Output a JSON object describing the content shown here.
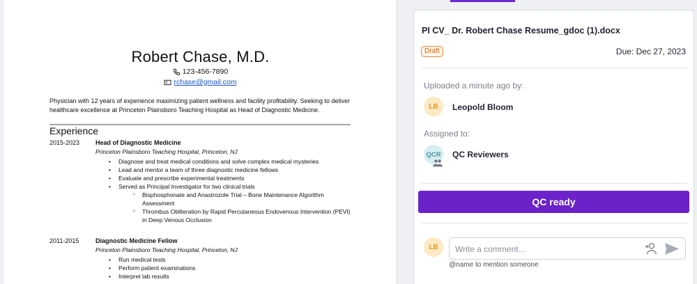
{
  "document": {
    "name": "Robert Chase, M.D.",
    "phone": "123-456-7890",
    "email": "rchase@gmail.com",
    "summary": "Physician with 12 years of experience maximizing patient wellness and facility profitability. Seeking to deliver healthcare excellence at Princeton Plainsboro Teaching Hospital as Head of Diagnostic Medicine.",
    "section_title": "Experience",
    "jobs": [
      {
        "years": "2015-2023",
        "title": "Head of Diagnostic Medicine",
        "org": "Princeton Plainsboro Teaching Hospital, Princeton, NJ",
        "bullets": [
          "Diagnose and treat medical conditions and solve complex medical mysteries",
          "Lead and mentor a team of three diagnostic medicine fellows",
          "Evaluate and prescribe experimental treatments",
          "Served as Principal Investigator for two clinical trials"
        ],
        "sub_bullets": [
          "Bisphosphonate and Anastrozole Trial – Bone Maintenance Algorithm Assessment",
          "Thrombus Obliteration by Rapid Percutaneous Endovenous Intervention (PEVI) in Deep Venous Occlusion"
        ]
      },
      {
        "years": "2011-2015",
        "title": "Diagnostic Medicine Fellow",
        "org": "Princeton Plainsboro Teaching Hospital, Princeton, NJ",
        "bullets": [
          "Run medical tests",
          "Perform patient examinations",
          "Interpret lab results"
        ]
      }
    ]
  },
  "panel": {
    "file_title": "PI CV_ Dr. Robert Chase Resume_gdoc (1).docx",
    "status": "Draft",
    "due": "Due: Dec 27, 2023",
    "uploaded_label": "Uploaded a minute ago by:",
    "uploader_initials": "LB",
    "uploader_name": "Leopold Bloom",
    "assigned_label": "Assigned to:",
    "assignee_initials": "QCR",
    "assignee_name": "QC Reviewers",
    "action_button": "QC ready",
    "commenter_initials": "LB",
    "comment_placeholder": "Write a comment...",
    "comment_hint": "@name to mention someone"
  },
  "colors": {
    "accent": "#6b22c9",
    "draft": "#e08a3c",
    "link": "#1a55c2"
  },
  "icons": [
    "phone-icon",
    "email-icon",
    "people-icon",
    "add-person-icon",
    "send-icon"
  ]
}
